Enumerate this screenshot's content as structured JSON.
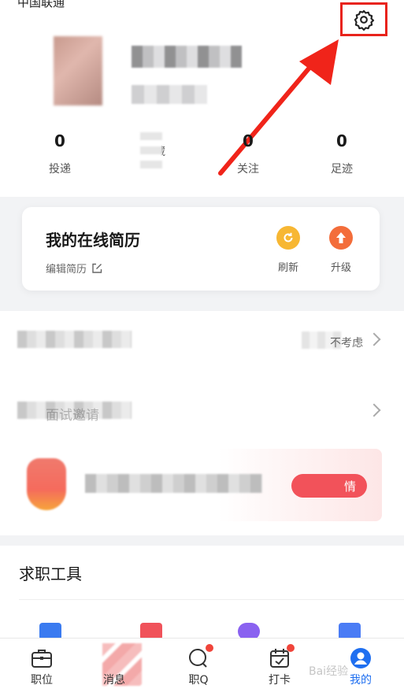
{
  "status_bar": {
    "left_text": "中国联通",
    "right_text": "…"
  },
  "profile": {
    "settings_icon": "gear-icon"
  },
  "stats": [
    {
      "value": "0",
      "label": "投递"
    },
    {
      "value": "",
      "label": "收藏"
    },
    {
      "value": "0",
      "label": "关注"
    },
    {
      "value": "0",
      "label": "足迹"
    }
  ],
  "resume_card": {
    "title": "我的在线简历",
    "edit_label": "编辑简历",
    "refresh_label": "刷新",
    "upgrade_label": "升级"
  },
  "list_rows": [
    {
      "label": "",
      "right_text": "不考虑"
    },
    {
      "label": "面试邀请",
      "right_text": ""
    }
  ],
  "promo": {
    "button_label": "情"
  },
  "tools": {
    "title": "求职工具"
  },
  "tabbar": {
    "items": [
      {
        "label": "职位",
        "icon": "briefcase-icon"
      },
      {
        "label": "消息",
        "icon": "message-icon"
      },
      {
        "label": "职Q",
        "icon": "qa-icon"
      },
      {
        "label": "打卡",
        "icon": "calendar-check-icon"
      },
      {
        "label": "我的",
        "icon": "user-icon"
      }
    ]
  },
  "colors": {
    "accent": "#1f6ff0",
    "highlight": "#e8231b",
    "refresh": "#f7b733",
    "upgrade": "#f36d3a",
    "promo_button": "#f2525a"
  },
  "watermark": "Bai经验"
}
